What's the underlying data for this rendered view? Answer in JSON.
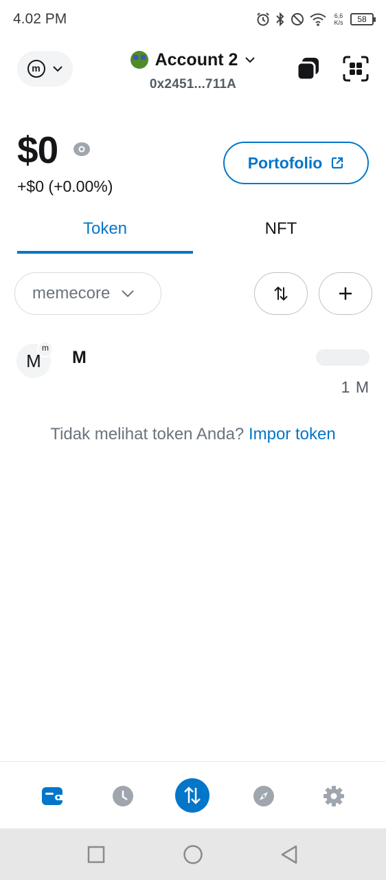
{
  "status_bar": {
    "time": "4.02 PM",
    "net_speed_value": "6,6",
    "net_speed_unit": "K/s",
    "battery": "58"
  },
  "header": {
    "network_logo_letter": "m",
    "account_name": "Account 2",
    "account_address": "0x2451...711A"
  },
  "balance": {
    "total": "$0",
    "change": "+$0 (+0.00%)",
    "portfolio_label": "Portofolio"
  },
  "tabs": [
    {
      "label": "Token",
      "active": true
    },
    {
      "label": "NFT",
      "active": false
    }
  ],
  "filter": {
    "network_label": "memecore"
  },
  "tokens": [
    {
      "icon_letter": "M",
      "badge_letter": "m",
      "name": "M",
      "amount": "1 M"
    }
  ],
  "import": {
    "prompt": "Tidak melihat token Anda?",
    "link": "Impor token"
  },
  "bottom_nav": [
    {
      "icon": "wallet-icon",
      "active": true
    },
    {
      "icon": "clock-icon",
      "active": false
    },
    {
      "icon": "swap-arrows-icon",
      "active": false
    },
    {
      "icon": "compass-icon",
      "active": false
    },
    {
      "icon": "gear-icon",
      "active": false
    }
  ],
  "colors": {
    "accent": "#0376c9",
    "text": "#141618",
    "muted": "#6a737d",
    "nav_inactive": "#9fa6ae"
  }
}
